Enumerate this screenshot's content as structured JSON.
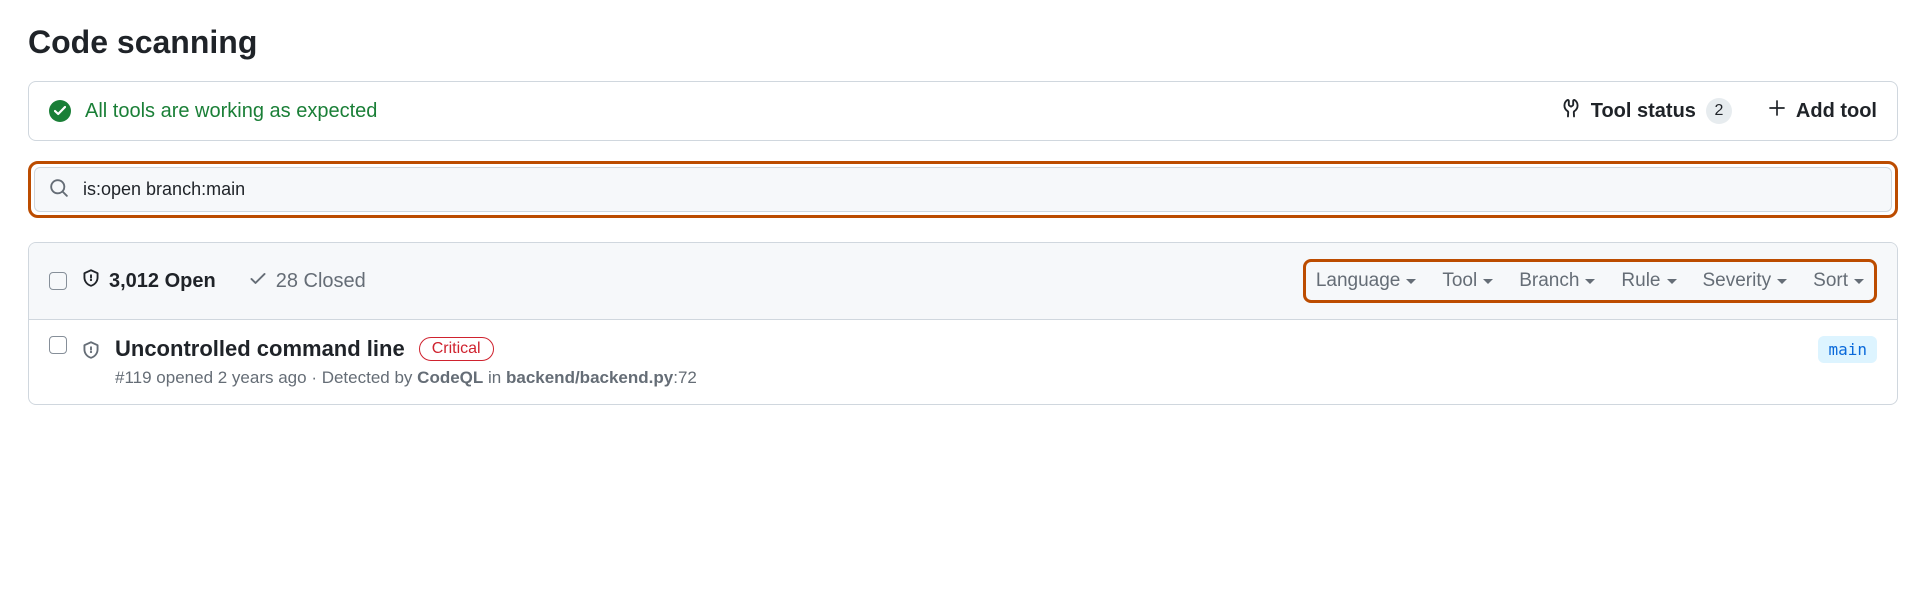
{
  "page_title": "Code scanning",
  "status": {
    "message": "All tools are working as expected",
    "tool_status_label": "Tool status",
    "tool_status_count": "2",
    "add_tool_label": "Add tool"
  },
  "search": {
    "value": "is:open branch:main"
  },
  "counts": {
    "open": "3,012 Open",
    "closed": "28 Closed"
  },
  "filters": [
    {
      "label": "Language"
    },
    {
      "label": "Tool"
    },
    {
      "label": "Branch"
    },
    {
      "label": "Rule"
    },
    {
      "label": "Severity"
    },
    {
      "label": "Sort"
    }
  ],
  "alerts": [
    {
      "title": "Uncontrolled command line",
      "severity": "Critical",
      "number": "#119",
      "opened": "opened 2 years ago",
      "detected_prefix": "Detected by",
      "tool": "CodeQL",
      "in": "in",
      "path": "backend/backend.py",
      "line": ":72",
      "branch": "main"
    }
  ]
}
